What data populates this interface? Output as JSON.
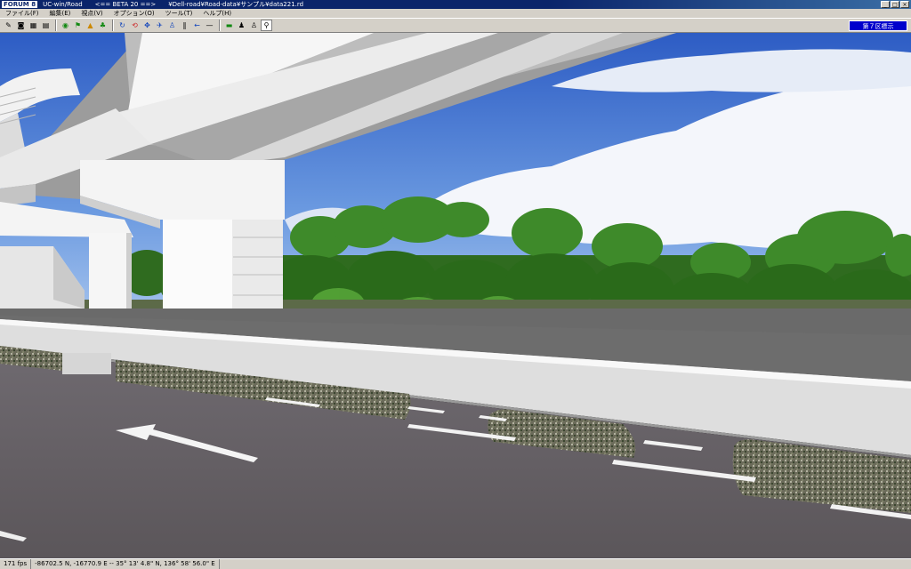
{
  "window": {
    "logo": "FORUM 8",
    "app": "UC-win/Road",
    "beta": "<== BETA 20 ==>",
    "file": "¥Dell-road¥Road-data¥サンプル¥data221.rd"
  },
  "menu": [
    "ファイル(F)",
    "編集(E)",
    "視点(V)",
    "オプション(O)",
    "ツール(T)",
    "ヘルプ(H)"
  ],
  "toolbar": {
    "icons": [
      "pencil-icon",
      "camera-icon",
      "grid-icon",
      "palette-icon",
      "globe-icon",
      "flag-icon",
      "cone-icon",
      "tree-icon",
      "rotate-icon",
      "reset-icon",
      "move-icon",
      "fly-icon",
      "person-icon",
      "pause-icon",
      "back-icon",
      "minus-icon",
      "road-icon",
      "person-icon",
      "walker-icon",
      "runner-icon"
    ],
    "badge": "第７区標示"
  },
  "status": {
    "fps": "171 fps",
    "coords": "-86702.5 N, -16770.9 E  -- 35° 13' 4.8\" N, 136° 58' 56.0\" E"
  },
  "colors": {
    "sky": "#3a6fd2",
    "road": "#6e6a6e",
    "titlebar": "#0a246a"
  }
}
